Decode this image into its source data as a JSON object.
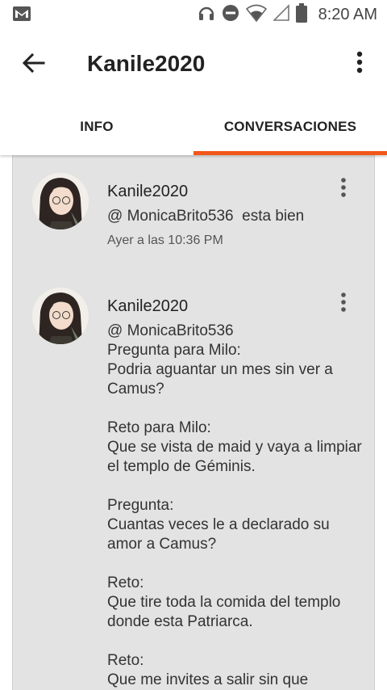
{
  "status_bar": {
    "time": "8:20 AM",
    "icons": [
      "gmail-icon",
      "headset-icon",
      "do-not-disturb-icon",
      "wifi-icon",
      "signal-icon",
      "battery-icon"
    ]
  },
  "app_bar": {
    "title": "Kanile2020",
    "back_icon": "arrow-left-icon",
    "menu_icon": "more-vertical-icon"
  },
  "tabs": [
    {
      "label": "INFO",
      "active": false
    },
    {
      "label": "CONVERSACIONES",
      "active": true
    }
  ],
  "colors": {
    "accent": "#f2571a",
    "panel_bg": "#e3e3e3"
  },
  "comments": [
    {
      "author": "Kanile2020",
      "text": "@ MonicaBrito536  esta bien",
      "time": "Ayer a las 10:36 PM"
    },
    {
      "author": "Kanile2020",
      "text": "@ MonicaBrito536\nPregunta para Milo:\nPodria aguantar un mes sin ver a Camus?\n\nReto para Milo:\nQue se vista de maid y vaya a limpiar el templo de Géminis.\n\nPregunta:\nCuantas veces le a declarado su amor a Camus?\n\nReto:\nQue tire toda la comida del templo donde esta Patriarca.\n\nReto:\nQue me invites a salir sin que"
    }
  ]
}
